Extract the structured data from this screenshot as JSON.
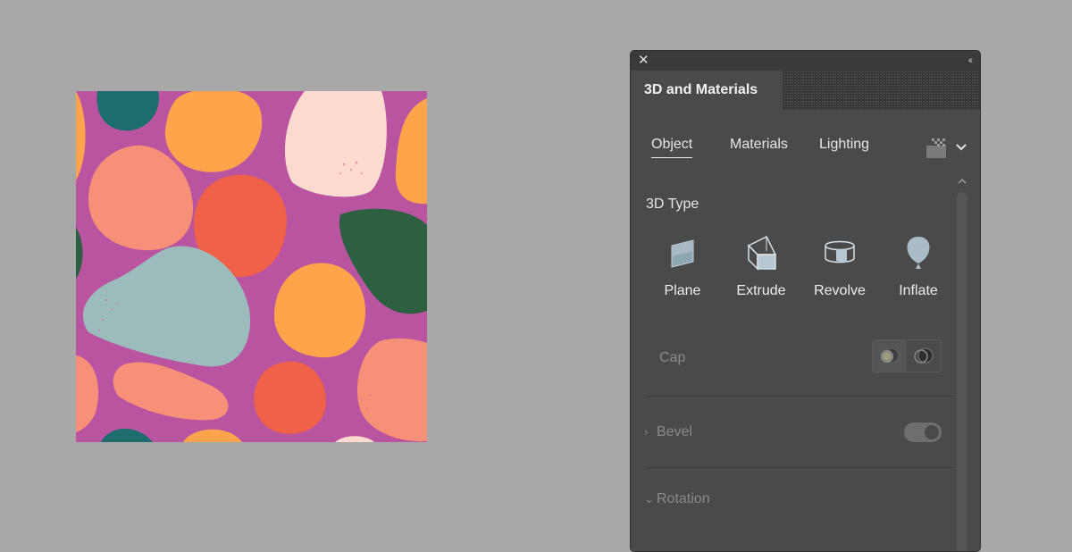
{
  "panel": {
    "title": "3D and Materials",
    "tabs": [
      {
        "label": "Object",
        "active": true
      },
      {
        "label": "Materials",
        "active": false
      },
      {
        "label": "Lighting",
        "active": false
      }
    ],
    "section_title": "3D Type",
    "types": [
      {
        "label": "Plane",
        "icon": "plane-icon"
      },
      {
        "label": "Extrude",
        "icon": "extrude-icon"
      },
      {
        "label": "Revolve",
        "icon": "revolve-icon"
      },
      {
        "label": "Inflate",
        "icon": "inflate-icon"
      }
    ],
    "cap_label": "Cap",
    "bevel_label": "Bevel",
    "rotation_label": "Rotation"
  },
  "colors": {
    "canvas_bg": "#a8a8a8",
    "panel_bg": "#4a4a4a",
    "artwork_bg": "#b954a0",
    "orange": "#ffa44b",
    "salmon": "#f69079",
    "red": "#ef6149",
    "peach": "#ffdacf",
    "teal": "#1e6d6d",
    "green": "#2d5f41",
    "mint": "#9cbcbc"
  }
}
